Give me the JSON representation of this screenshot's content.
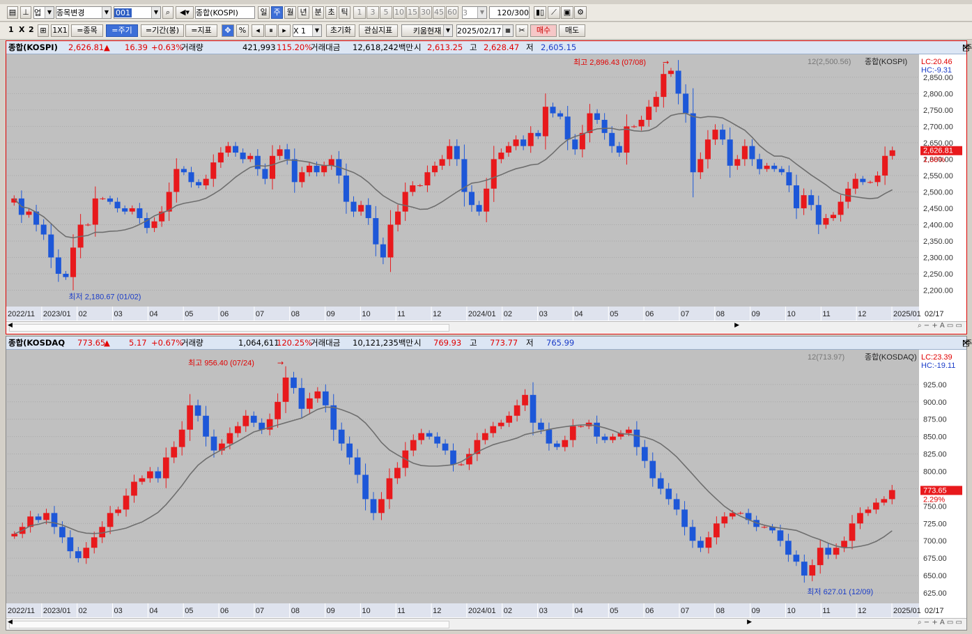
{
  "toolbar1": {
    "market": "업",
    "change_stock": "종목변경",
    "code": "001",
    "index_name": "종합(KOSPI)",
    "periods": [
      "일",
      "주",
      "월",
      "년",
      "분",
      "초",
      "틱"
    ],
    "active_period": "주",
    "intervals": [
      "1",
      "3",
      "5",
      "10",
      "15",
      "30",
      "45",
      "60"
    ],
    "count_sel": "3",
    "view_count": "120",
    "total_count": "/300"
  },
  "toolbar2": {
    "layout": [
      "1",
      "X",
      "2"
    ],
    "grid_label": "1X1",
    "items": [
      "=종목",
      "=주기",
      "=기간(봉)",
      "=지표"
    ],
    "active_item": "=주기",
    "pct": "%",
    "mult": "X 1",
    "reset": "초기화",
    "watch": "관심지표",
    "kiwoom": "키움현재",
    "date": "2025/02/17",
    "buy": "매수",
    "sell": "매도"
  },
  "panels": [
    {
      "name": "종합(KOSPI)",
      "price": "2,626.81",
      "arrow": "▲",
      "change": "16.39",
      "change_pct": "+0.63%",
      "vol_label": "거래량",
      "volume": "421,993",
      "vol_pct": "115.20%",
      "amt_label": "거래대금",
      "amount": "12,618,242백만",
      "open_label": "시",
      "open": "2,613.25",
      "high_label": "고",
      "high": "2,628.47",
      "low_label": "저",
      "low": "2,605.15",
      "ma_label": "12(2,500.56)",
      "series_label": "종합(KOSPI)",
      "lc": "LC:20.46",
      "hc": "HC:-9.31",
      "price_tag": "2,626.81",
      "pct_tag": "1.38%",
      "max_label": "최고 2,896.43 (07/08)",
      "min_label": "최저 2,180.67 (01/02)",
      "end_label": "02/17",
      "x_labels": [
        "2022/11",
        "2023/01",
        "02",
        "03",
        "04",
        "05",
        "06",
        "07",
        "08",
        "09",
        "10",
        "11",
        "12",
        "2024/01",
        "02",
        "03",
        "04",
        "05",
        "06",
        "07",
        "08",
        "09",
        "10",
        "11",
        "12",
        "2025/01"
      ]
    },
    {
      "name": "종합(KOSDAQ",
      "price": "773.65",
      "arrow": "▲",
      "change": "5.17",
      "change_pct": "+0.67%",
      "vol_label": "거래량",
      "volume": "1,064,611",
      "vol_pct": "120.25%",
      "amt_label": "거래대금",
      "amount": "10,121,235백만",
      "open_label": "시",
      "open": "769.93",
      "high_label": "고",
      "high": "773.77",
      "low_label": "저",
      "low": "765.99",
      "ma_label": "12(713.97)",
      "series_label": "종합(KOSDAQ)",
      "lc": "LC:23.39",
      "hc": "HC:-19.11",
      "price_tag": "773.65",
      "pct_tag": "2.29%",
      "max_label": "최고 956.40 (07/24)",
      "min_label": "최저 627.01 (12/09)",
      "end_label": "02/17",
      "x_labels": [
        "2022/11",
        "2023/01",
        "02",
        "03",
        "04",
        "05",
        "06",
        "07",
        "08",
        "09",
        "10",
        "11",
        "12",
        "2024/01",
        "02",
        "03",
        "04",
        "05",
        "06",
        "07",
        "08",
        "09",
        "10",
        "11",
        "12",
        "2025/01"
      ]
    }
  ],
  "chart_data": [
    {
      "type": "candlestick",
      "title": "종합(KOSPI)",
      "period": "weekly",
      "y_ticks": [
        2200,
        2250,
        2300,
        2350,
        2400,
        2450,
        2500,
        2550,
        2600,
        2650,
        2700,
        2750,
        2800,
        2850
      ],
      "ylim": [
        2150,
        2920
      ],
      "moving_average": "12",
      "closes": [
        2480,
        2430,
        2440,
        2400,
        2370,
        2300,
        2250,
        2240,
        2330,
        2400,
        2400,
        2480,
        2480,
        2470,
        2450,
        2440,
        2450,
        2420,
        2390,
        2410,
        2440,
        2500,
        2570,
        2560,
        2530,
        2520,
        2540,
        2590,
        2620,
        2640,
        2620,
        2600,
        2610,
        2570,
        2540,
        2610,
        2630,
        2600,
        2530,
        2560,
        2580,
        2560,
        2580,
        2600,
        2550,
        2470,
        2440,
        2460,
        2420,
        2340,
        2300,
        2400,
        2440,
        2500,
        2520,
        2520,
        2560,
        2580,
        2600,
        2640,
        2600,
        2500,
        2460,
        2440,
        2510,
        2600,
        2620,
        2640,
        2660,
        2640,
        2680,
        2670,
        2760,
        2740,
        2730,
        2660,
        2630,
        2680,
        2740,
        2720,
        2680,
        2640,
        2620,
        2700,
        2700,
        2720,
        2760,
        2790,
        2860,
        2870,
        2800,
        2740,
        2560,
        2600,
        2660,
        2690,
        2660,
        2580,
        2600,
        2640,
        2600,
        2570,
        2580,
        2570,
        2560,
        2520,
        2450,
        2490,
        2460,
        2400,
        2420,
        2430,
        2470,
        2510,
        2540,
        2530,
        2530,
        2550,
        2610,
        2627
      ],
      "high": 2896.43,
      "low": 2180.67
    },
    {
      "type": "candlestick",
      "title": "종합(KOSDAQ",
      "period": "weekly",
      "y_ticks": [
        625,
        650,
        675,
        700,
        725,
        750,
        775,
        800,
        825,
        850,
        875,
        900,
        925
      ],
      "ylim": [
        610,
        975
      ],
      "moving_average": "12",
      "closes": [
        710,
        720,
        735,
        730,
        740,
        720,
        705,
        685,
        675,
        690,
        705,
        720,
        740,
        745,
        765,
        785,
        790,
        800,
        790,
        820,
        835,
        860,
        895,
        880,
        850,
        830,
        840,
        855,
        865,
        880,
        870,
        860,
        875,
        900,
        935,
        920,
        890,
        905,
        915,
        895,
        860,
        840,
        820,
        795,
        760,
        740,
        760,
        790,
        805,
        830,
        845,
        855,
        850,
        840,
        830,
        810,
        810,
        825,
        845,
        855,
        865,
        870,
        880,
        895,
        910,
        870,
        860,
        840,
        835,
        845,
        865,
        865,
        870,
        850,
        845,
        850,
        855,
        860,
        835,
        815,
        790,
        775,
        760,
        745,
        720,
        700,
        690,
        705,
        725,
        735,
        740,
        740,
        730,
        720,
        720,
        715,
        700,
        680,
        670,
        650,
        665,
        690,
        680,
        690,
        700,
        725,
        740,
        745,
        755,
        760,
        773
      ],
      "high": 956.4,
      "low": 627.01
    }
  ]
}
